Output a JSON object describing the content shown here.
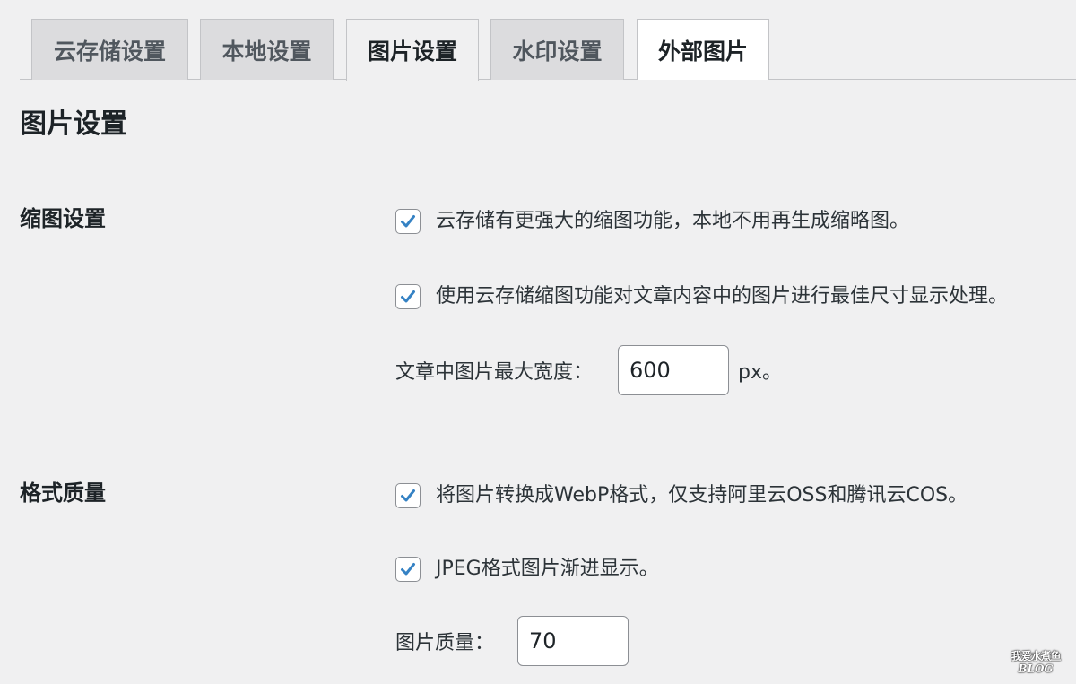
{
  "tabs": [
    {
      "label": "云存储设置",
      "state": "inactive"
    },
    {
      "label": "本地设置",
      "state": "inactive"
    },
    {
      "label": "图片设置",
      "state": "active"
    },
    {
      "label": "水印设置",
      "state": "inactive"
    },
    {
      "label": "外部图片",
      "state": "white"
    }
  ],
  "page_title": "图片设置",
  "sections": {
    "thumbnail": {
      "label": "缩图设置",
      "option1": {
        "checked": true,
        "label": "云存储有更强大的缩图功能，本地不用再生成缩略图。"
      },
      "option2": {
        "checked": true,
        "label": "使用云存储缩图功能对文章内容中的图片进行最佳尺寸显示处理。"
      },
      "max_width": {
        "label": "文章中图片最大宽度：",
        "value": "600",
        "unit": "px。"
      }
    },
    "format": {
      "label": "格式质量",
      "option1": {
        "checked": true,
        "label": "将图片转换成WebP格式，仅支持阿里云OSS和腾讯云COS。"
      },
      "option2": {
        "checked": true,
        "label": "JPEG格式图片渐进显示。"
      },
      "quality": {
        "label": "图片质量：",
        "value": "70"
      }
    }
  },
  "watermark": {
    "top": "我爱水煮鱼",
    "bottom": "BLOG"
  },
  "colors": {
    "background": "#f0f0f1",
    "tab_inactive": "#dcdcde",
    "check_accent": "#3582c4",
    "border": "#8c8f94"
  },
  "icons": {
    "checkbox_mark": "checkmark-icon"
  }
}
